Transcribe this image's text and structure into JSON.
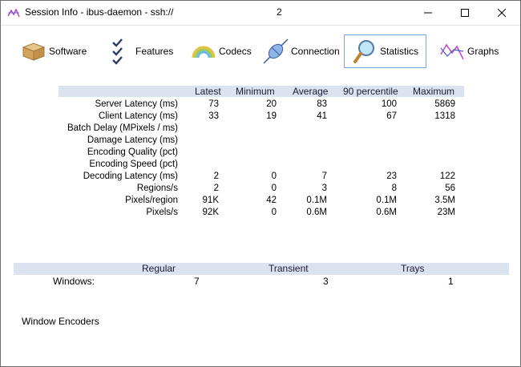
{
  "window": {
    "title": "Session Info - ibus-daemon - ssh://",
    "title_number": "2",
    "icons": [
      "app-icon",
      "minimize-icon",
      "maximize-icon",
      "close-icon"
    ]
  },
  "toolbar": {
    "items": [
      {
        "label": "Software",
        "icon": "box-icon"
      },
      {
        "label": "Features",
        "icon": "checklist-icon"
      },
      {
        "label": "Codecs",
        "icon": "rainbow-icon"
      },
      {
        "label": "Connection",
        "icon": "plug-icon"
      },
      {
        "label": "Statistics",
        "icon": "magnifier-icon",
        "active": true
      },
      {
        "label": "Graphs",
        "icon": "graph-icon"
      }
    ]
  },
  "stats": {
    "headers": [
      "Latest",
      "Minimum",
      "Average",
      "90 percentile",
      "Maximum"
    ],
    "rows": [
      {
        "label": "Server Latency (ms)",
        "values": [
          "73",
          "20",
          "83",
          "100",
          "5869"
        ]
      },
      {
        "label": "Client Latency (ms)",
        "values": [
          "33",
          "19",
          "41",
          "67",
          "1318"
        ]
      },
      {
        "label": "Batch Delay (MPixels / ms)",
        "values": [
          "",
          "",
          "",
          "",
          ""
        ]
      },
      {
        "label": "Damage Latency (ms)",
        "values": [
          "",
          "",
          "",
          "",
          ""
        ]
      },
      {
        "label": "Encoding Quality (pct)",
        "values": [
          "",
          "",
          "",
          "",
          ""
        ]
      },
      {
        "label": "Encoding Speed (pct)",
        "values": [
          "",
          "",
          "",
          "",
          ""
        ]
      },
      {
        "label": "Decoding Latency (ms)",
        "values": [
          "2",
          "0",
          "7",
          "23",
          "122"
        ]
      },
      {
        "label": "Regions/s",
        "values": [
          "2",
          "0",
          "3",
          "8",
          "56"
        ]
      },
      {
        "label": "Pixels/region",
        "values": [
          "91K",
          "42",
          "0.1M",
          "0.1M",
          "3.5M"
        ]
      },
      {
        "label": "Pixels/s",
        "values": [
          "92K",
          "0",
          "0.6M",
          "0.6M",
          "23M"
        ]
      }
    ]
  },
  "windows_table": {
    "headers": [
      "Regular",
      "Transient",
      "Trays"
    ],
    "row_label": "Windows:",
    "values": [
      "7",
      "3",
      "1"
    ]
  },
  "encoders_label": "Window Encoders"
}
